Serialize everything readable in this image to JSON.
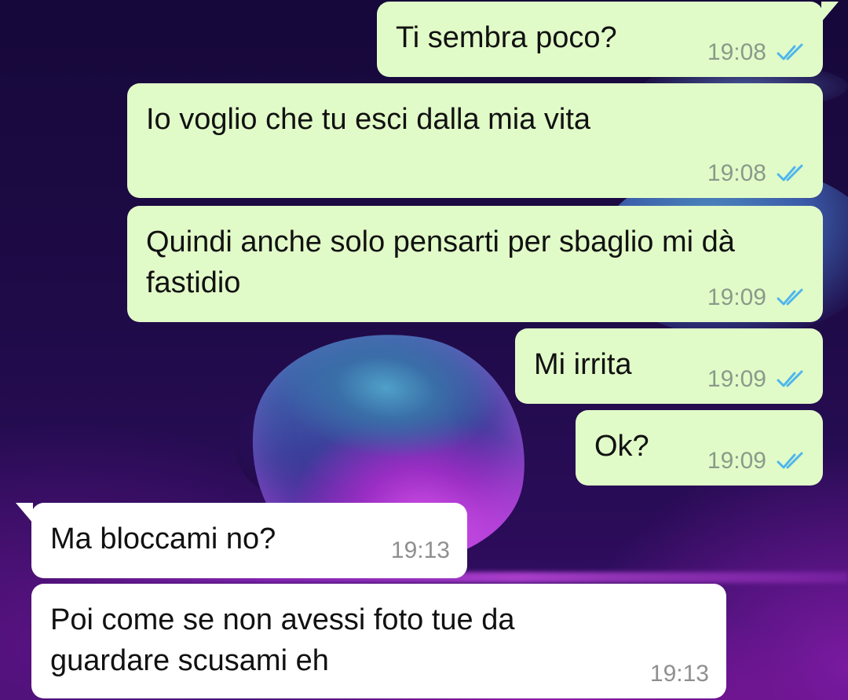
{
  "messages": [
    {
      "direction": "out",
      "text": "Ti sembra poco?",
      "time": "19:08",
      "status": "read"
    },
    {
      "direction": "out",
      "text": "Io voglio che tu esci dalla mia vita",
      "time": "19:08",
      "status": "read"
    },
    {
      "direction": "out",
      "text": "Quindi anche solo pensarti per sbaglio mi dà fastidio",
      "time": "19:09",
      "status": "read"
    },
    {
      "direction": "out",
      "text": "Mi irrita",
      "time": "19:09",
      "status": "read"
    },
    {
      "direction": "out",
      "text": "Ok?",
      "time": "19:09",
      "status": "read"
    },
    {
      "direction": "in",
      "text": "Ma bloccami no?",
      "time": "19:13"
    },
    {
      "direction": "in",
      "text": "Poi come se non avessi foto tue da guardare scusami eh",
      "time": "19:13"
    }
  ],
  "icons": {
    "read_receipt": "double-check-icon"
  },
  "colors": {
    "outgoing_bubble": "#e1fbc8",
    "incoming_bubble": "#ffffff",
    "read_tick": "#4fb6ec",
    "timestamp": "#8a9a8a"
  }
}
